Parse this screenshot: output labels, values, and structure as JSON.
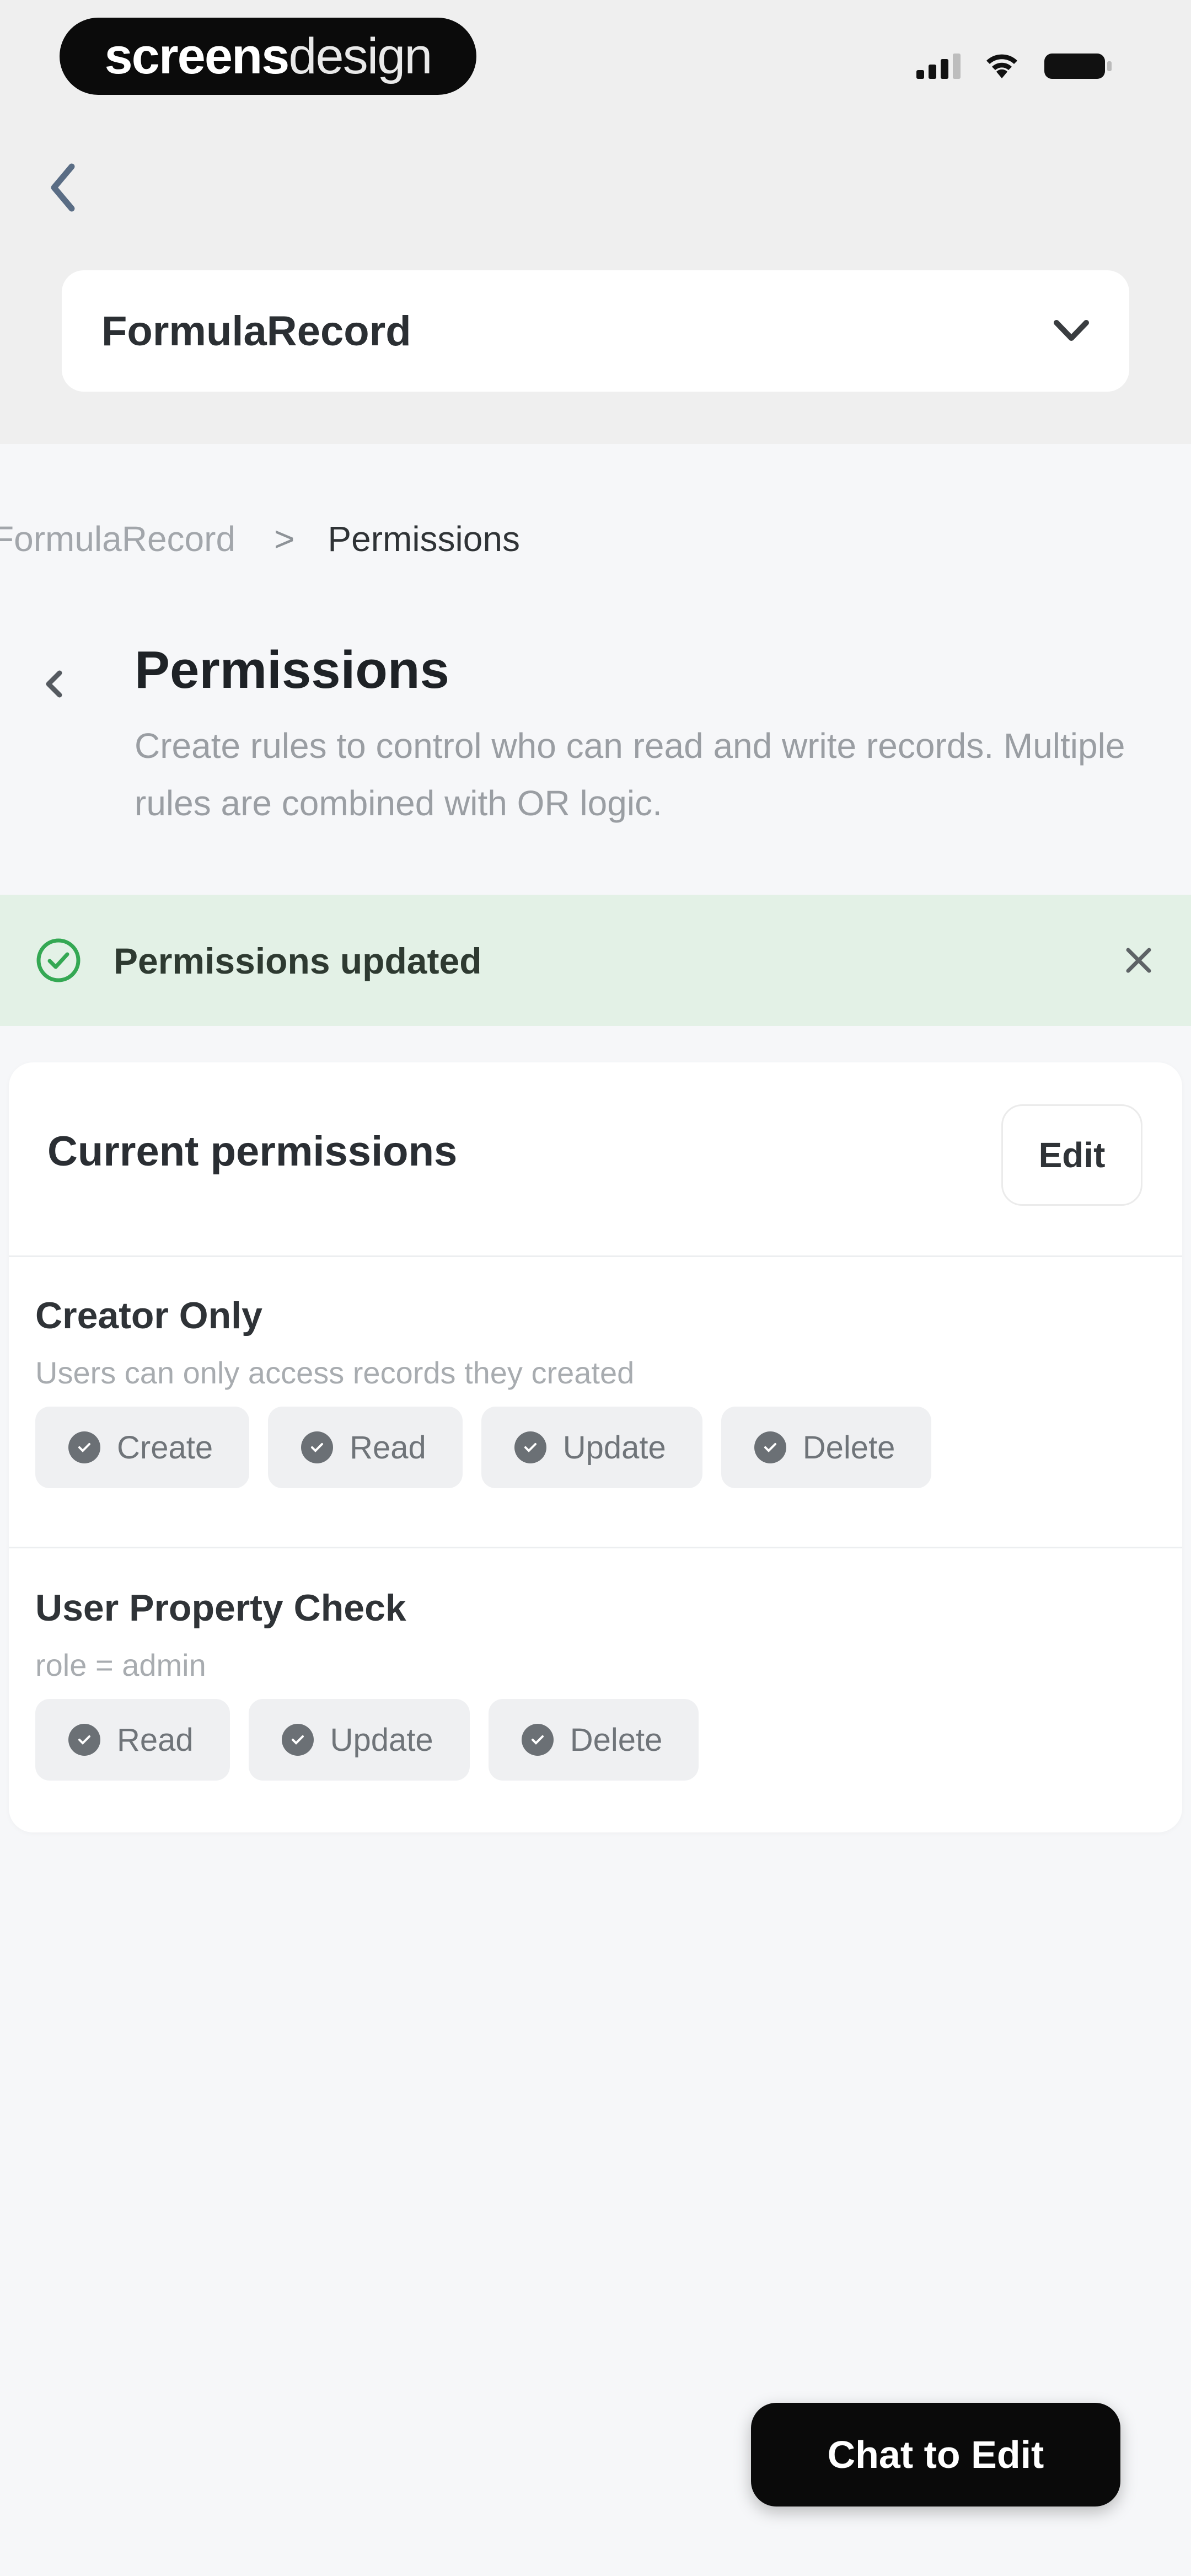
{
  "status_bar": {
    "logo_bold": "screens",
    "logo_light": "design",
    "icons": [
      "signal-icon",
      "wifi-icon",
      "battery-icon"
    ]
  },
  "top_nav": {
    "back_icon": "chevron-left-icon",
    "dropdown": {
      "selected": "FormulaRecord",
      "icon": "chevron-down-icon"
    }
  },
  "breadcrumb": {
    "items": [
      "FormulaRecord",
      "Permissions"
    ],
    "separator": ">"
  },
  "header": {
    "back_icon": "chevron-left-icon",
    "title": "Permissions",
    "description": "Create rules to control who can read and write records. Multiple rules are combined with OR logic."
  },
  "toast": {
    "icon": "check-circle-icon",
    "message": "Permissions updated",
    "close_icon": "close-icon",
    "bg_color": "#e3f1e6",
    "accent_color": "#34a853"
  },
  "card": {
    "title": "Current permissions",
    "edit_label": "Edit",
    "rules": [
      {
        "name": "Creator Only",
        "description": "Users can only access records they created",
        "permissions": [
          "Create",
          "Read",
          "Update",
          "Delete"
        ]
      },
      {
        "name": "User Property Check",
        "description": "role = admin",
        "permissions": [
          "Read",
          "Update",
          "Delete"
        ]
      }
    ]
  },
  "footer": {
    "chat_label": "Chat to Edit"
  }
}
